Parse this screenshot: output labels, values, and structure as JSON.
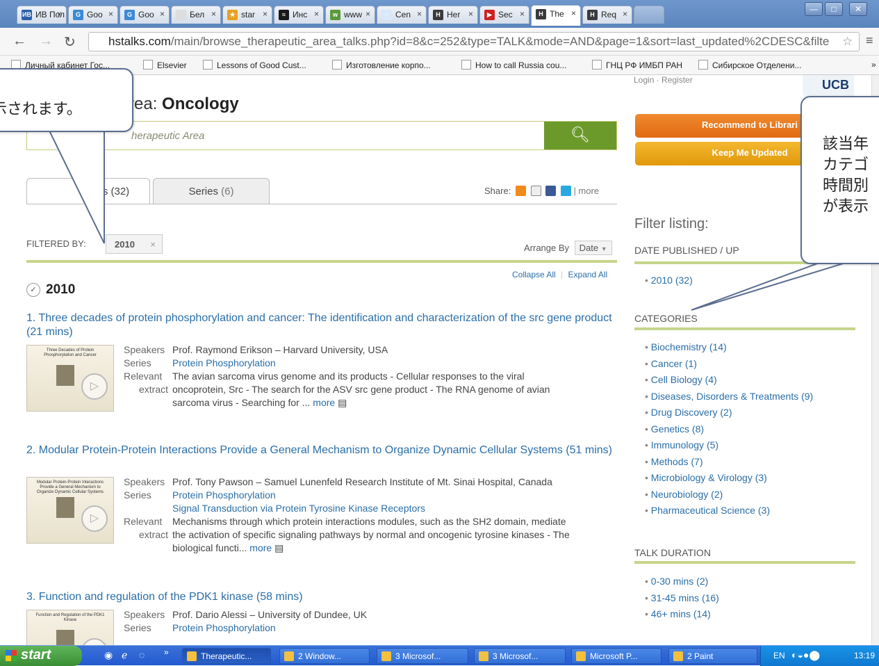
{
  "tabs": [
    {
      "label": "ИВ Пол",
      "fav": "ИВ",
      "color": "#2a5fa8"
    },
    {
      "label": "Goo",
      "fav": "G",
      "color": "#3b8ad8"
    },
    {
      "label": "Goo",
      "fav": "G",
      "color": "#3b8ad8"
    },
    {
      "label": "Бел",
      "fav": "",
      "color": "#ddd"
    },
    {
      "label": "star",
      "fav": "★",
      "color": "#e8a020"
    },
    {
      "label": "Инс",
      "fav": "≈",
      "color": "#1a1a1a"
    },
    {
      "label": "www",
      "fav": "w",
      "color": "#5a9a3a"
    },
    {
      "label": "Cen",
      "fav": "○",
      "color": "#d8e8f8"
    },
    {
      "label": "Her",
      "fav": "H",
      "color": "#3a3a3a"
    },
    {
      "label": "Sec",
      "fav": "▶",
      "color": "#d02020"
    },
    {
      "label": "The",
      "fav": "H",
      "color": "#3a3a3a"
    },
    {
      "label": "Req",
      "fav": "H",
      "color": "#3a3a3a"
    }
  ],
  "url": {
    "domain": "hstalks.com",
    "path": "/main/browse_therapeutic_area_talks.php?id=8&c=252&type=TALK&mode=AND&page=1&sort=last_updated%2CDESC&filte"
  },
  "bookmarks": [
    "Личный кабинет Гос...",
    "Elsevier",
    "Lessons of Good Cust...",
    "Изготовление корпо...",
    "How to call Russia cou...",
    "ГНЦ РФ ИМБП РАН",
    "Сибирское Отделени..."
  ],
  "header": {
    "prefix": "rea: ",
    "title": "Oncology",
    "top_links": "Login · Register"
  },
  "search": {
    "placeholder": "herapeutic Area"
  },
  "page_tabs": [
    {
      "label": "s (32)"
    },
    {
      "label": "Series",
      "count": "(6)"
    }
  ],
  "share": {
    "label": "Share:",
    "more": "| more"
  },
  "filter": {
    "label": "FILTERED BY:",
    "chip": "2010",
    "chip_x": "×"
  },
  "arrange": {
    "label": "Arrange By",
    "value": "Date"
  },
  "collapse": {
    "collapse": "Collapse All",
    "sep": "|",
    "expand": "Expand All"
  },
  "year": "2010",
  "talks": [
    {
      "title": "1. Three decades of protein phosphorylation and cancer: The identification and characterization of the src gene product (21 mins)",
      "thumb_title": "Three Decades of Protein Phosphorylation and Cancer",
      "speaker": "Prof. Raymond Erikson",
      "affil": "Harvard University, USA",
      "series": [
        "Protein Phosphorylation"
      ],
      "extract": [
        "The avian sarcoma virus genome and its products - Cellular responses to the viral",
        "oncoprotein, Src - The search for the ASV src gene product - The RNA genome of avian",
        "sarcoma virus - Searching for ... "
      ]
    },
    {
      "title": "2. Modular Protein-Protein Interactions Provide a General Mechanism to Organize Dynamic Cellular Systems (51 mins)",
      "thumb_title": "Modular Protein-Protein Interactions Provide a General Mechanism to Organize Dynamic Cellular Systems",
      "speaker": "Prof. Tony Pawson",
      "affil": "Samuel Lunenfeld Research Institute of Mt. Sinai Hospital, Canada",
      "series": [
        "Protein Phosphorylation",
        "Signal Transduction via Protein Tyrosine Kinase Receptors"
      ],
      "extract": [
        "Mechanisms through which protein interactions modules, such as the SH2 domain, mediate",
        "the activation of specific signaling pathways by normal and oncogenic tyrosine kinases - The",
        "biological functi... "
      ]
    },
    {
      "title": "3. Function and regulation of the PDK1 kinase (58 mins)",
      "thumb_title": "Function and Regulation of the PDK1 Kinase",
      "speaker": "Prof. Dario Alessi",
      "affil": "University of Dundee, UK",
      "series": [
        "Protein Phosphorylation"
      ],
      "extract": []
    }
  ],
  "labels": {
    "speakers": "Speakers",
    "series": "Series",
    "relevant": "Relevant",
    "extract": "extract",
    "more": "more",
    "dash": "–"
  },
  "right": {
    "recommend": "Recommend to Librari",
    "keep": "Keep Me Updated",
    "filter_title": "Filter listing:",
    "date_head": "DATE PUBLISHED / UP",
    "dates": [
      "2010 (32)"
    ],
    "cat_head": "CATEGORIES",
    "categories": [
      "Biochemistry (14)",
      "Cancer (1)",
      "Cell Biology (4)",
      "Diseases, Disorders & Treatments (9)",
      "Drug Discovery (2)",
      "Genetics (8)",
      "Immunology (5)",
      "Methods (7)",
      "Microbiology & Virology (3)",
      "Neurobiology (2)",
      "Pharmaceutical Science (3)"
    ],
    "dur_head": "TALK DURATION",
    "durations": [
      "0-30 mins (2)",
      "31-45 mins (16)",
      "46+ mins (14)"
    ]
  },
  "callouts": {
    "left": "示されます。",
    "right": [
      "該当年",
      "カテゴ",
      "時間別",
      "が表示"
    ]
  },
  "taskbar": {
    "start": "start",
    "items": [
      "Therapeutic...",
      "2 Window...",
      "3 Microsof...",
      "3 Microsof...",
      "Microsoft P...",
      "2 Paint"
    ],
    "lang": "EN",
    "time": "13:19"
  },
  "colors": {
    "accent": "#2a6ea8",
    "green": "#6b9a2b",
    "orange": "#e8761e",
    "yellow": "#e8a81e"
  }
}
